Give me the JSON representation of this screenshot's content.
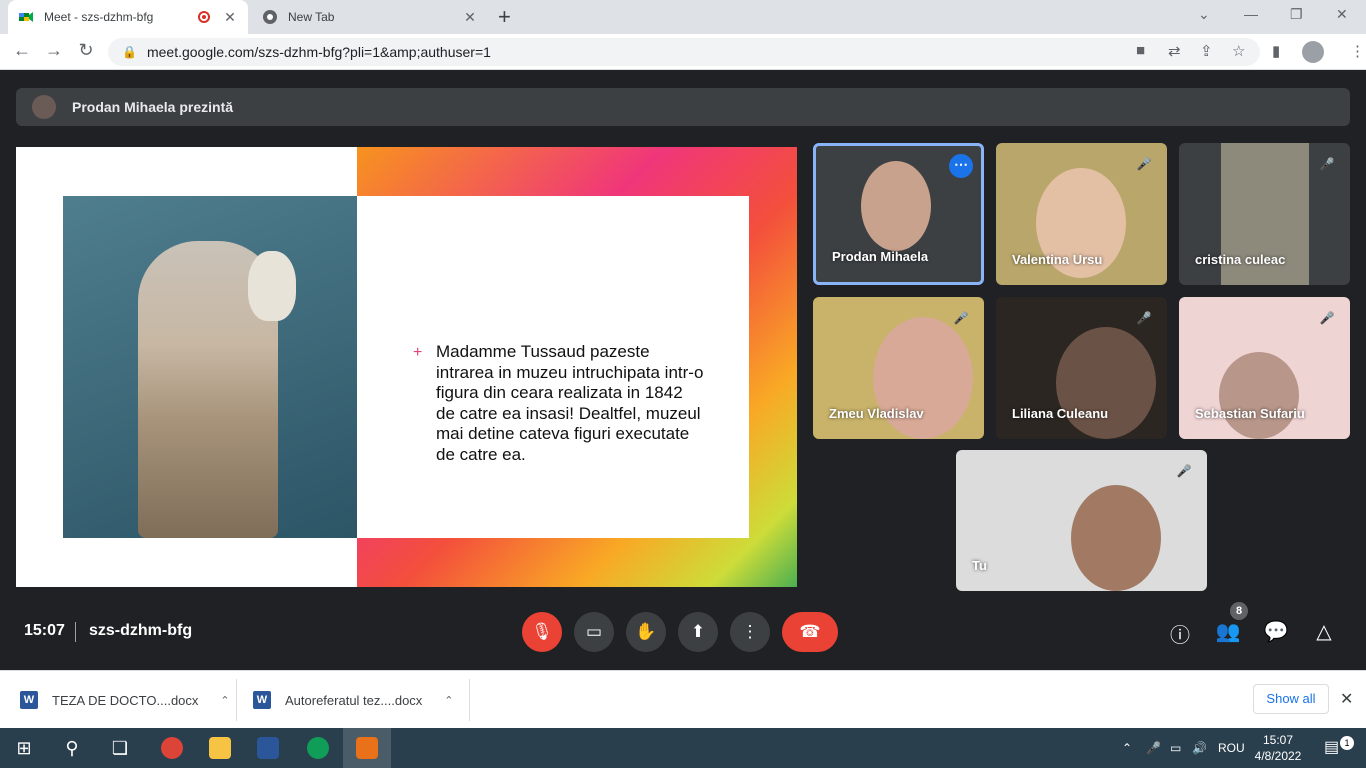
{
  "browser": {
    "tabs": [
      {
        "title": "Meet - szs-dzhm-bfg",
        "active": true
      },
      {
        "title": "New Tab",
        "active": false
      }
    ],
    "url": "meet.google.com/szs-dzhm-bfg?pli=1&amp;authuser=1"
  },
  "meet": {
    "presenter_banner": "Prodan Mihaela prezintă",
    "slide": {
      "bullet": "+",
      "text": "Madamme Tussaud pazeste intrarea in muzeu intruchipata intr-o figura din ceara realizata in 1842 de catre ea insasi! Dealtfel, muzeul mai detine cateva figuri executate de catre ea."
    },
    "participants": [
      {
        "name": "Prodan Mihaela",
        "muted": false,
        "speaking": true
      },
      {
        "name": "Valentina Ursu",
        "muted": true
      },
      {
        "name": "cristina culeac",
        "muted": true
      },
      {
        "name": "Zmeu Vladislav",
        "muted": true
      },
      {
        "name": "Liliana Culeanu",
        "muted": true
      },
      {
        "name": "Sebastian Sufariu",
        "muted": true
      },
      {
        "name": "Tu",
        "muted": true
      }
    ],
    "time": "15:07",
    "meeting_code": "szs-dzhm-bfg",
    "people_count": "8",
    "colors": {
      "hangup": "#ea4335",
      "active_border": "#8ab4f8",
      "accent": "#1a73e8"
    }
  },
  "downloads": {
    "items": [
      "TEZA DE DOCTO....docx",
      "Autoreferatul tez....docx"
    ],
    "show_all": "Show all"
  },
  "taskbar": {
    "language": "ROU",
    "time": "15:07",
    "date": "4/8/2022",
    "notifications": "1"
  }
}
